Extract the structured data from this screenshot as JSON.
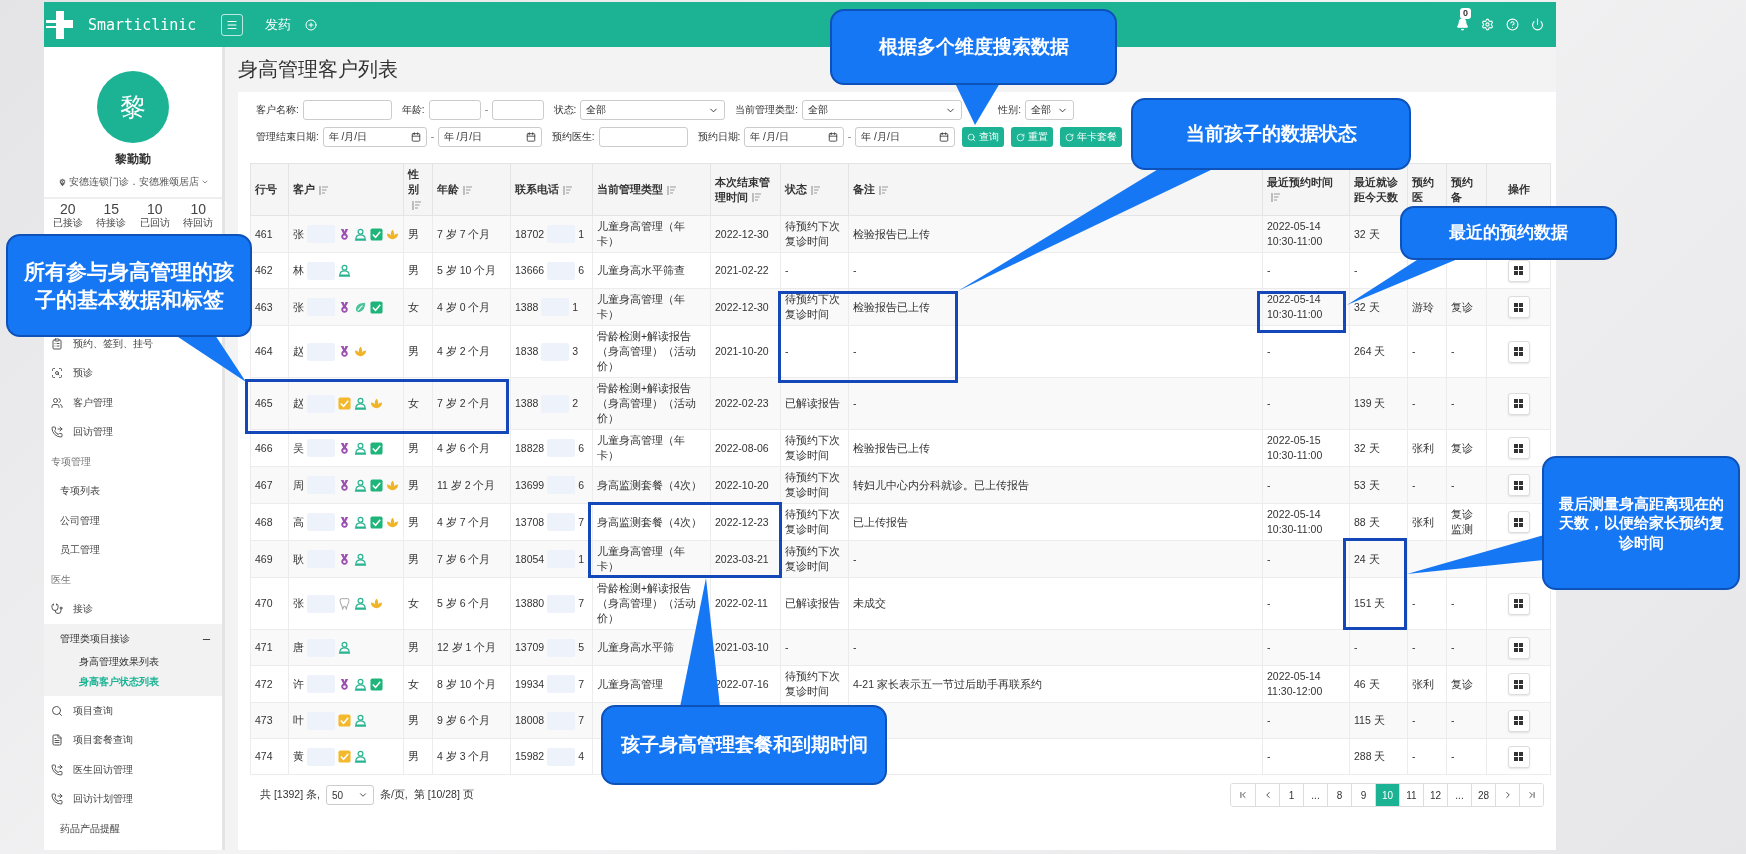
{
  "topbar": {
    "brand": "Smarticlinic",
    "nav": "发药",
    "notifications": "0"
  },
  "sidebar": {
    "avatar": "黎",
    "name": "黎勤勤",
    "location": "安德连锁门诊．安德雅颂居店",
    "stats": [
      {
        "value": "20",
        "label": "已接诊"
      },
      {
        "value": "15",
        "label": "待接诊"
      },
      {
        "value": "10",
        "label": "已回访"
      },
      {
        "value": "10",
        "label": "待回访"
      }
    ],
    "items": [
      {
        "kind": "item",
        "label": "预约、签到、挂号"
      },
      {
        "kind": "item",
        "label": "预诊"
      },
      {
        "kind": "item",
        "label": "客户管理"
      },
      {
        "kind": "item",
        "label": "回访管理"
      },
      {
        "kind": "section",
        "label": "专项管理"
      },
      {
        "kind": "subitem",
        "label": "专项列表"
      },
      {
        "kind": "subitem",
        "label": "公司管理"
      },
      {
        "kind": "subitem",
        "label": "员工管理"
      },
      {
        "kind": "section",
        "label": "医生"
      },
      {
        "kind": "item",
        "label": "接诊"
      },
      {
        "kind": "group",
        "label": "管理类项目接诊",
        "expanded": true,
        "children": [
          {
            "label": "身高管理效果列表",
            "selected": false
          },
          {
            "label": "身高客户状态列表",
            "selected": true
          }
        ]
      },
      {
        "kind": "item",
        "label": "项目查询"
      },
      {
        "kind": "item",
        "label": "项目套餐查询"
      },
      {
        "kind": "item",
        "label": "医生回访管理"
      },
      {
        "kind": "item",
        "label": "回访计划管理"
      },
      {
        "kind": "subitem",
        "label": "药品产品提醒"
      }
    ]
  },
  "page_title": "身高管理客户列表",
  "filters": {
    "row_1": [
      {
        "label": "客户名称:",
        "kind": "input"
      },
      {
        "label": "年龄:",
        "kind": "range"
      },
      {
        "label": "状态:",
        "kind": "select",
        "value": "全部"
      },
      {
        "label": "当前管理类型:",
        "kind": "select",
        "value": "全部"
      },
      {
        "label": "性别:",
        "kind": "select",
        "value": "全部"
      }
    ],
    "row_2": [
      {
        "label": "管理结束日期:",
        "kind": "daterange",
        "fields": [
          {
            "placeholder": "年 /月/日"
          },
          {
            "placeholder": "年 /月/日"
          }
        ]
      },
      {
        "label": "预约医生:",
        "kind": "input"
      },
      {
        "label": "预约日期:",
        "kind": "daterange",
        "fields": [
          {
            "placeholder": "年 /月/日"
          },
          {
            "placeholder": "年 /月/日"
          }
        ]
      }
    ],
    "buttons": [
      {
        "label": "查询",
        "kind": "search"
      },
      {
        "label": "重置",
        "kind": "reset"
      },
      {
        "label": "年卡套餐",
        "kind": "reset"
      }
    ]
  },
  "table": {
    "columns": [
      {
        "label": "行号",
        "sortable": false
      },
      {
        "label": "客户",
        "sortable": true
      },
      {
        "label": "性别",
        "sortable": true
      },
      {
        "label": "年龄",
        "sortable": true
      },
      {
        "label": "联系电话",
        "sortable": true
      },
      {
        "label": "当前管理类型",
        "sortable": true
      },
      {
        "label": "本次结束管理时间",
        "sortable": true
      },
      {
        "label": "状态",
        "sortable": true
      },
      {
        "label": "备注",
        "sortable": true
      },
      {
        "label": "最近预约时间",
        "sortable": true
      },
      {
        "label": "最近就诊距今天数",
        "sortable": false
      },
      {
        "label": "预约医",
        "sortable": false
      },
      {
        "label": "预约备",
        "sortable": false
      },
      {
        "label": "操作",
        "sortable": false
      }
    ],
    "rows": [
      {
        "no": "461",
        "surname": "张",
        "tags": [
          {
            "kind": "medal"
          },
          {
            "kind": "person"
          },
          {
            "kind": "check"
          },
          {
            "kind": "lotus"
          }
        ],
        "gender": "男",
        "age": "7 岁 7 个月",
        "phone_head": "18702",
        "phone_tail": "1",
        "plan": "儿童身高管理（年卡）",
        "end_date": "2022-12-30",
        "status": "待预约下次复诊时间",
        "remark": "检验报告已上传",
        "appt_time": "2022-05-14 10:30-11:00",
        "days": "32 天",
        "has_action": false
      },
      {
        "no": "462",
        "surname": "林",
        "tags": [
          {
            "kind": "person"
          }
        ],
        "gender": "男",
        "age": "5 岁 10 个月",
        "phone_head": "13666",
        "phone_tail": "6",
        "plan": "儿童身高水平筛查",
        "end_date": "2021-02-22",
        "status": "-",
        "remark": "-",
        "appt_time": "-",
        "days": "-",
        "has_action": true
      },
      {
        "no": "463",
        "surname": "张",
        "tags": [
          {
            "kind": "medal"
          },
          {
            "kind": "leaf"
          },
          {
            "kind": "check"
          }
        ],
        "gender": "女",
        "age": "4 岁 0 个月",
        "phone_head": "1388",
        "phone_tail": "1",
        "plan": "儿童身高管理（年卡）",
        "end_date": "2022-12-30",
        "status": "待预约下次复诊时间",
        "remark": "检验报告已上传",
        "appt_time": "2022-05-14 10:30-11:00",
        "days": "32 天",
        "doctor": "游玲",
        "appt_note": "复诊",
        "has_action": true
      },
      {
        "no": "464",
        "surname": "赵",
        "tags": [
          {
            "kind": "medal"
          },
          {
            "kind": "lotus"
          }
        ],
        "gender": "男",
        "age": "4 岁 2 个月",
        "phone_head": "1838",
        "phone_tail": "3",
        "plan": "骨龄检测+解读报告（身高管理）（活动价）",
        "end_date": "2021-10-20",
        "status": "-",
        "remark": "-",
        "appt_time": "-",
        "days": "264 天",
        "doctor": "-",
        "appt_note": "-",
        "has_action": true
      },
      {
        "no": "465",
        "surname": "赵",
        "tags": [
          {
            "kind": "note"
          },
          {
            "kind": "person"
          },
          {
            "kind": "lotus"
          }
        ],
        "gender": "女",
        "age": "7 岁 2 个月",
        "phone_head": "1388",
        "phone_tail": "2",
        "plan": "骨龄检测+解读报告（身高管理）（活动价）",
        "end_date": "2022-02-23",
        "status": "已解读报告",
        "remark": "-",
        "appt_time": "-",
        "days": "139 天",
        "doctor": "-",
        "appt_note": "-",
        "has_action": true
      },
      {
        "no": "466",
        "surname": "吴",
        "tags": [
          {
            "kind": "medal"
          },
          {
            "kind": "person"
          },
          {
            "kind": "check"
          }
        ],
        "gender": "男",
        "age": "4 岁 6 个月",
        "phone_head": "18828",
        "phone_tail": "6",
        "plan": "儿童身高管理（年卡）",
        "end_date": "2022-08-06",
        "status": "待预约下次复诊时间",
        "remark": "检验报告已上传",
        "appt_time": "2022-05-15 10:30-11:00",
        "days": "32 天",
        "doctor": "张利",
        "appt_note": "复诊",
        "has_action": true
      },
      {
        "no": "467",
        "surname": "周",
        "tags": [
          {
            "kind": "medal"
          },
          {
            "kind": "person"
          },
          {
            "kind": "check"
          },
          {
            "kind": "lotus"
          }
        ],
        "gender": "男",
        "age": "11 岁 2 个月",
        "phone_head": "13699",
        "phone_tail": "6",
        "plan": "身高监测套餐（4次）",
        "end_date": "2022-10-20",
        "status": "待预约下次复诊时间",
        "remark": "转妇儿中心内分科就诊。已上传报告",
        "appt_time": "-",
        "days": "53 天",
        "doctor": "-",
        "appt_note": "-",
        "has_action": true
      },
      {
        "no": "468",
        "surname": "高",
        "tags": [
          {
            "kind": "medal"
          },
          {
            "kind": "person"
          },
          {
            "kind": "check"
          },
          {
            "kind": "lotus"
          }
        ],
        "gender": "男",
        "age": "4 岁 7 个月",
        "phone_head": "13708",
        "phone_tail": "7",
        "plan": "身高监测套餐（4次）",
        "end_date": "2022-12-23",
        "status": "待预约下次复诊时间",
        "remark": "已上传报告",
        "appt_time": "2022-05-14 10:30-11:00",
        "days": "88 天",
        "doctor": "张利",
        "appt_note": "复诊监测",
        "has_action": true
      },
      {
        "no": "469",
        "surname": "耿",
        "tags": [
          {
            "kind": "medal"
          },
          {
            "kind": "person"
          }
        ],
        "gender": "男",
        "age": "7 岁 6 个月",
        "phone_head": "18054",
        "phone_tail": "1",
        "plan": "儿童身高管理（年卡）",
        "end_date": "2023-03-21",
        "status": "待预约下次复诊时间",
        "remark": "-",
        "appt_time": "-",
        "days": "24 天",
        "has_action": false
      },
      {
        "no": "470",
        "surname": "张",
        "tags": [
          {
            "kind": "tooth"
          },
          {
            "kind": "person"
          },
          {
            "kind": "lotus"
          }
        ],
        "gender": "女",
        "age": "5 岁 6 个月",
        "phone_head": "13880",
        "phone_tail": "7",
        "plan": "骨龄检测+解读报告（身高管理）（活动价）",
        "end_date": "2022-02-11",
        "status": "已解读报告",
        "remark": "未成交",
        "appt_time": "-",
        "days": "151 天",
        "doctor": "-",
        "appt_note": "-",
        "has_action": true
      },
      {
        "no": "471",
        "surname": "唐",
        "tags": [
          {
            "kind": "person"
          }
        ],
        "gender": "男",
        "age": "12 岁 1 个月",
        "phone_head": "13709",
        "phone_tail": "5",
        "plan": "儿童身高水平筛",
        "end_date": "2021-03-10",
        "status": "-",
        "remark": "-",
        "appt_time": "-",
        "days": "-",
        "doctor": "-",
        "appt_note": "-",
        "has_action": true
      },
      {
        "no": "472",
        "surname": "许",
        "tags": [
          {
            "kind": "medal"
          },
          {
            "kind": "person"
          },
          {
            "kind": "check"
          }
        ],
        "gender": "女",
        "age": "8 岁 10 个月",
        "phone_head": "19934",
        "phone_tail": "7",
        "plan": "儿童身高管理",
        "end_date": "2022-07-16",
        "status": "待预约下次复诊时间",
        "remark": "4-21 家长表示五一节过后助手再联系约",
        "appt_time": "2022-05-14 11:30-12:00",
        "days": "46 天",
        "doctor": "张利",
        "appt_note": "复诊",
        "has_action": true
      },
      {
        "no": "473",
        "surname": "叶",
        "tags": [
          {
            "kind": "note"
          },
          {
            "kind": "person"
          }
        ],
        "gender": "男",
        "age": "9 岁 6 个月",
        "phone_head": "18008",
        "phone_tail": "7",
        "appt_time": "-",
        "days": "115 天",
        "doctor": "-",
        "appt_note": "-",
        "has_action": true
      },
      {
        "no": "474",
        "surname": "黄",
        "tags": [
          {
            "kind": "note"
          },
          {
            "kind": "person"
          }
        ],
        "gender": "男",
        "age": "4 岁 3 个月",
        "phone_head": "15982",
        "phone_tail": "4",
        "appt_time": "-",
        "days": "288 天",
        "doctor": "-",
        "appt_note": "-",
        "has_action": true
      }
    ]
  },
  "footer": {
    "total": "共 [1392] 条,",
    "page_size": "50",
    "per_page": "条/页,",
    "page_info": "第 [10/28] 页"
  },
  "pagination": [
    {
      "label": "1",
      "selected": false
    },
    {
      "label": "...",
      "selected": false
    },
    {
      "label": "8",
      "selected": false
    },
    {
      "label": "9",
      "selected": false
    },
    {
      "label": "10",
      "selected": true
    },
    {
      "label": "11",
      "selected": false
    },
    {
      "label": "12",
      "selected": false
    },
    {
      "label": "...",
      "selected": false
    },
    {
      "label": "28",
      "selected": false
    }
  ],
  "annotations": [
    {
      "text": "根据多个维度搜索数据"
    },
    {
      "text": "当前孩子的数据状态"
    },
    {
      "text": "所有参与身高管理的孩子的基本数据和标签"
    },
    {
      "text": "最近的预约数据"
    },
    {
      "text": "最后测量身高距离现在的天数，以便给家长预约复诊时间"
    },
    {
      "text": "孩子身高管理套餐和到期时间"
    }
  ]
}
